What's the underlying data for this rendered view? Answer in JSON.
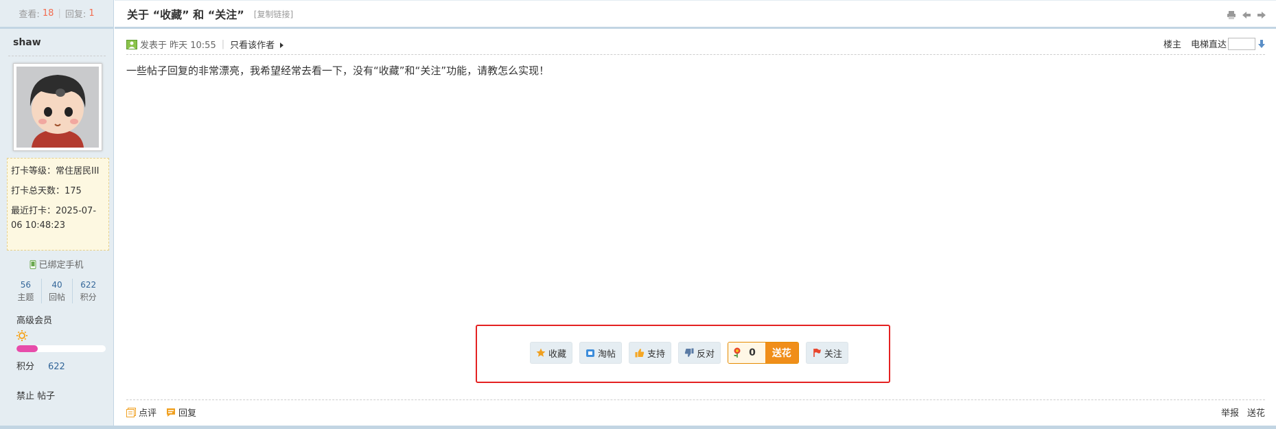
{
  "stats": {
    "views_label": "查看:",
    "views": "18",
    "replies_label": "回复:",
    "replies": "1"
  },
  "thread": {
    "title": "关于 “收藏” 和 “关注”",
    "copy_link": "[复制链接]"
  },
  "user": {
    "name": "shaw",
    "checkin_level": "打卡等级：常住居民III",
    "checkin_total": "打卡总天数：175",
    "checkin_last": "最近打卡：2025-07-06 10:48:23",
    "phone_bound": "已绑定手机",
    "counts": [
      {
        "value": "56",
        "label": "主题"
      },
      {
        "value": "40",
        "label": "回帖"
      },
      {
        "value": "622",
        "label": "积分"
      }
    ],
    "group": "高级会员",
    "level_progress_percent": 24,
    "score_label": "积分",
    "score_value": "622",
    "ban_label": "禁止 帖子"
  },
  "post": {
    "published": "发表于 昨天 10:55",
    "author_only": "只看该作者",
    "floor": "楼主",
    "elevator": "电梯直达",
    "body": "一些帖子回复的非常漂亮，我希望经常去看一下，没有“收藏”和“关注”功能，请教怎么实现！"
  },
  "actions": {
    "favorite": "收藏",
    "taotie": "淘帖",
    "support": "支持",
    "oppose": "反对",
    "flower_count": "0",
    "send_flower": "送花",
    "follow": "关注"
  },
  "footer": {
    "comment": "点评",
    "reply": "回复",
    "report": "举报",
    "send_flower": "送花"
  },
  "colors": {
    "accent": "#f26c4f",
    "highlight_frame": "#e42121",
    "flower_button": "#f08e1a",
    "sidebar_bg": "#e5edf2"
  }
}
